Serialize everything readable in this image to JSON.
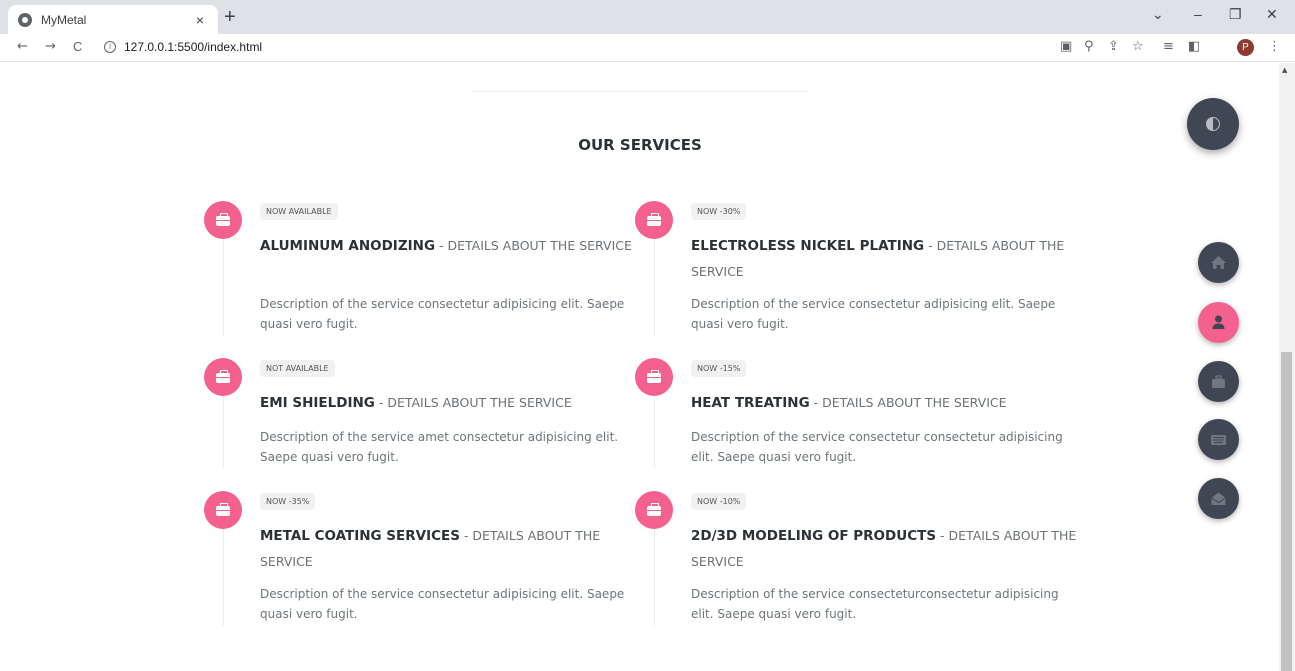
{
  "browser": {
    "tab_title": "MyMetal",
    "tab_close": "×",
    "new_tab": "+",
    "url": "127.0.0.1:5500/index.html",
    "info_glyph": "i",
    "back": "←",
    "forward": "→",
    "reload": "C",
    "profile_initial": "P",
    "window_controls": {
      "dropdown": "⌄",
      "minimize": "–",
      "restore": "❐",
      "close": "✕"
    },
    "toolbar_icons": {
      "translate": "▣",
      "zoom": "⚲",
      "share": "⇪",
      "bookmark": "☆",
      "reading_list": "≡",
      "side_panel": "◧",
      "menu": "⋮"
    }
  },
  "section": {
    "title": "OUR SERVICES"
  },
  "services": [
    {
      "badge": "NOW AVAILABLE",
      "name": "ALUMINUM ANODIZING",
      "subtitle": " - DETAILS ABOUT THE SERVICE",
      "description": "Description of the service consectetur adipisicing elit. Saepe quasi vero fugit."
    },
    {
      "badge": "NOW -30%",
      "name": "ELECTROLESS NICKEL PLATING",
      "subtitle": " - DETAILS ABOUT THE SERVICE",
      "description": "Description of the service consectetur adipisicing elit. Saepe quasi vero fugit."
    },
    {
      "badge": "NOT AVAILABLE",
      "name": "EMI SHIELDING",
      "subtitle": " - DETAILS ABOUT THE SERVICE",
      "description": "Description of the service amet consectetur adipisicing elit. Saepe quasi vero fugit."
    },
    {
      "badge": "NOW -15%",
      "name": "HEAT TREATING",
      "subtitle": " - DETAILS ABOUT THE SERVICE",
      "description": "Description of the service consectetur consectetur adipisicing elit. Saepe quasi vero fugit."
    },
    {
      "badge": "NOW -35%",
      "name": "METAL COATING SERVICES",
      "subtitle": " - DETAILS ABOUT THE SERVICE",
      "description": "Description of the service consectetur adipisicing elit. Saepe quasi vero fugit."
    },
    {
      "badge": "NOW -10%",
      "name": "2D/3D MODELING OF PRODUCTS",
      "subtitle": " - DETAILS ABOUT THE SERVICE",
      "description": "Description of the service consecteturconsectetur adipisicing elit. Saepe quasi vero fugit."
    }
  ],
  "floating_nav": {
    "theme_toggle_icon": "contrast-icon",
    "items": [
      {
        "icon": "home-icon",
        "active": false
      },
      {
        "icon": "user-icon",
        "active": true
      },
      {
        "icon": "briefcase-icon",
        "active": false
      },
      {
        "icon": "keyboard-icon",
        "active": false
      },
      {
        "icon": "envelope-open-icon",
        "active": false
      }
    ]
  },
  "colors": {
    "accent": "#f5618e",
    "dark": "#3e4753",
    "heading": "#2a3138",
    "text": "#6c757d"
  }
}
